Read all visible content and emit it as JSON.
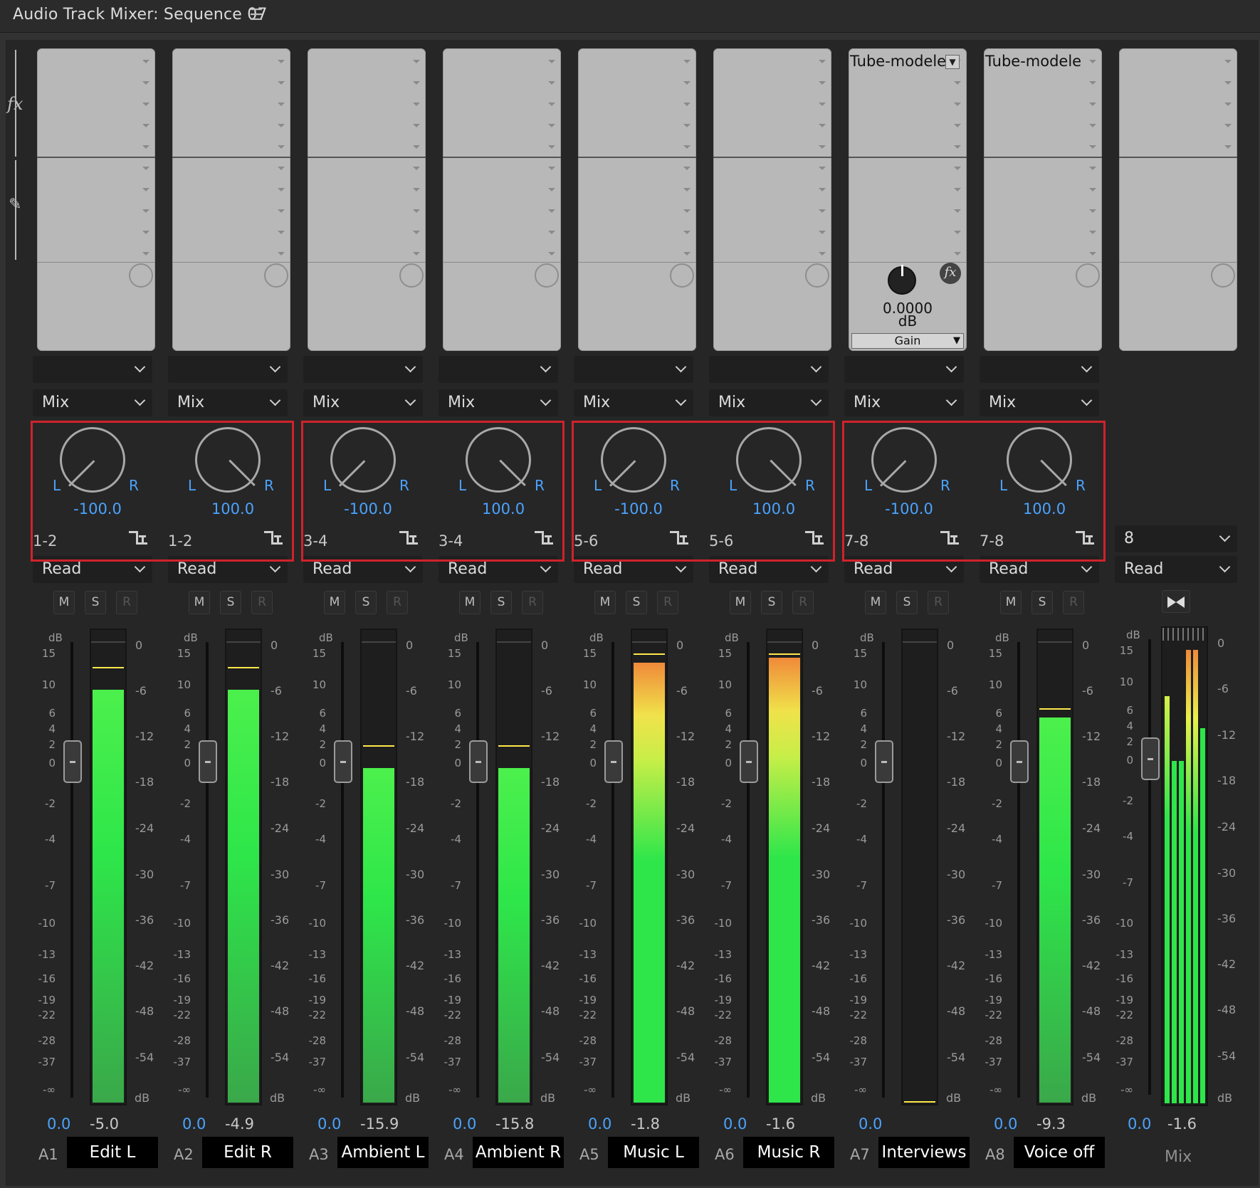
{
  "window": {
    "title": "Audio Track Mixer: Sequence 07"
  },
  "colors": {
    "accent": "#4aa3ff",
    "highlight": "#d0222b",
    "meter_green": "#2ee64a",
    "meter_yellow": "#e9f04a",
    "meter_orange": "#f08a3a",
    "peak": "#ffe94a"
  },
  "scale": {
    "fader_ticks": [
      "15",
      "10",
      "6",
      "4",
      "2",
      "0",
      "-2",
      "-4",
      "-7",
      "-10",
      "-13",
      "-16",
      "-19",
      "-22",
      "-28",
      "-37",
      "-∞"
    ],
    "meter_ticks": [
      "0",
      "-6",
      "-12",
      "-18",
      "-24",
      "-30",
      "-36",
      "-42",
      "-48",
      "-54",
      "dB"
    ],
    "db_label": "dB"
  },
  "labels": {
    "m": "M",
    "s": "S",
    "r": "R",
    "L": "L",
    "R": "R"
  },
  "tracks": [
    {
      "id": "A1",
      "name": "Edit L",
      "send": "",
      "mode": "Mix",
      "pan": "-100.0",
      "channels": "1-2",
      "automation": "Read",
      "volume": "0.0",
      "level": "-5.0",
      "meter_level": 0.9,
      "peak_level": 0.95
    },
    {
      "id": "A2",
      "name": "Edit R",
      "send": "",
      "mode": "Mix",
      "pan": "100.0",
      "channels": "1-2",
      "automation": "Read",
      "volume": "0.0",
      "level": "-4.9",
      "meter_level": 0.9,
      "peak_level": 0.95
    },
    {
      "id": "A3",
      "name": "Ambient L",
      "send": "",
      "mode": "Mix",
      "pan": "-100.0",
      "channels": "3-4",
      "automation": "Read",
      "volume": "0.0",
      "level": "-15.9",
      "meter_level": 0.73,
      "peak_level": 0.78
    },
    {
      "id": "A4",
      "name": "Ambient R",
      "send": "",
      "mode": "Mix",
      "pan": "100.0",
      "channels": "3-4",
      "automation": "Read",
      "volume": "0.0",
      "level": "-15.8",
      "meter_level": 0.73,
      "peak_level": 0.78
    },
    {
      "id": "A5",
      "name": "Music L",
      "send": "",
      "mode": "Mix",
      "pan": "-100.0",
      "channels": "5-6",
      "automation": "Read",
      "volume": "0.0",
      "level": "-1.8",
      "meter_level": 0.96,
      "peak_level": 0.98
    },
    {
      "id": "A6",
      "name": "Music R",
      "send": "",
      "mode": "Mix",
      "pan": "100.0",
      "channels": "5-6",
      "automation": "Read",
      "volume": "0.0",
      "level": "-1.6",
      "meter_level": 0.97,
      "peak_level": 0.98
    },
    {
      "id": "A7",
      "name": "Interviews",
      "send": "",
      "mode": "Mix",
      "pan": "-100.0",
      "channels": "7-8",
      "automation": "Read",
      "volume": "0.0",
      "level": "",
      "meter_level": 0,
      "peak_level": 0,
      "effect": {
        "name": "Tube-modele",
        "param_value": "0.0000",
        "param_unit": "dB",
        "param_name": "Gain"
      }
    },
    {
      "id": "A8",
      "name": "Voice off",
      "send": "",
      "mode": "Mix",
      "pan": "100.0",
      "channels": "7-8",
      "automation": "Read",
      "volume": "0.0",
      "level": "-9.3",
      "meter_level": 0.84,
      "peak_level": 0.86,
      "effect": {
        "name": "Tube-modele"
      }
    }
  ],
  "master": {
    "name": "Mix",
    "channels": "8",
    "automation": "Read",
    "volume": "0.0",
    "level": "-1.6",
    "meter_levels": [
      0.88,
      0.74,
      0.74,
      0.98,
      0.98,
      0.81
    ]
  }
}
